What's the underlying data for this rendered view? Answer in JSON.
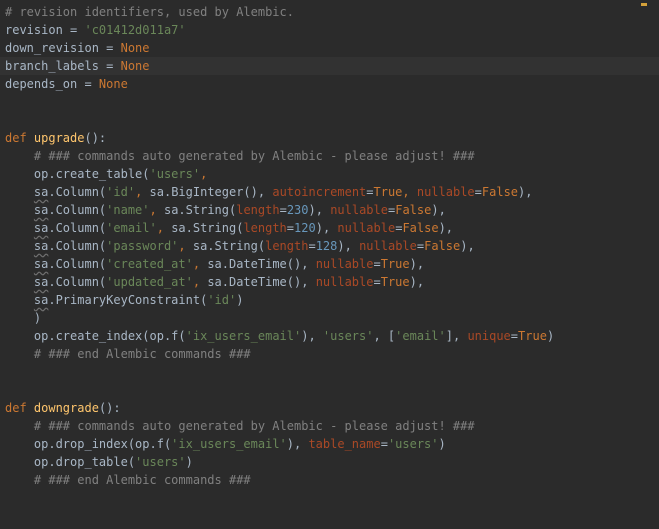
{
  "editor": {
    "current_line_index": 3,
    "lines": [
      [
        {
          "t": "# revision identifiers, used by Alembic.",
          "c": "com"
        }
      ],
      [
        {
          "t": "revision = ",
          "c": "plain"
        },
        {
          "t": "'c01412d011a7'",
          "c": "str"
        }
      ],
      [
        {
          "t": "down_revision = ",
          "c": "plain"
        },
        {
          "t": "None",
          "c": "kw"
        }
      ],
      [
        {
          "t": "branch_labels = ",
          "c": "plain"
        },
        {
          "t": "None",
          "c": "kw"
        }
      ],
      [
        {
          "t": "depends_on = ",
          "c": "plain"
        },
        {
          "t": "None",
          "c": "kw"
        }
      ],
      [],
      [],
      [
        {
          "t": "def ",
          "c": "kw"
        },
        {
          "t": "upgrade",
          "c": "fn"
        },
        {
          "t": "():",
          "c": "plain"
        }
      ],
      [
        {
          "t": "    # ### commands auto generated by Alembic - please adjust! ###",
          "c": "com"
        }
      ],
      [
        {
          "t": "    op.create_table(",
          "c": "plain"
        },
        {
          "t": "'users'",
          "c": "str"
        },
        {
          "t": ",",
          "c": "kw"
        }
      ],
      [
        {
          "t": "    ",
          "c": "plain"
        },
        {
          "t": "sa",
          "c": "sq"
        },
        {
          "t": ".Column(",
          "c": "plain"
        },
        {
          "t": "'id'",
          "c": "str"
        },
        {
          "t": ", ",
          "c": "kw"
        },
        {
          "t": "sa.BigInteger(), ",
          "c": "plain"
        },
        {
          "t": "autoincrement",
          "c": "kwarg"
        },
        {
          "t": "=",
          "c": "plain"
        },
        {
          "t": "True",
          "c": "kw"
        },
        {
          "t": ", ",
          "c": "kw"
        },
        {
          "t": "nullable",
          "c": "kwarg"
        },
        {
          "t": "=",
          "c": "plain"
        },
        {
          "t": "False",
          "c": "kw"
        },
        {
          "t": "),",
          "c": "plain"
        }
      ],
      [
        {
          "t": "    ",
          "c": "plain"
        },
        {
          "t": "sa",
          "c": "sq"
        },
        {
          "t": ".Column(",
          "c": "plain"
        },
        {
          "t": "'name'",
          "c": "str"
        },
        {
          "t": ", ",
          "c": "kw"
        },
        {
          "t": "sa.String(",
          "c": "plain"
        },
        {
          "t": "length",
          "c": "kwarg"
        },
        {
          "t": "=",
          "c": "plain"
        },
        {
          "t": "230",
          "c": "num"
        },
        {
          "t": "), ",
          "c": "plain"
        },
        {
          "t": "nullable",
          "c": "kwarg"
        },
        {
          "t": "=",
          "c": "plain"
        },
        {
          "t": "False",
          "c": "kw"
        },
        {
          "t": "),",
          "c": "plain"
        }
      ],
      [
        {
          "t": "    ",
          "c": "plain"
        },
        {
          "t": "sa",
          "c": "sq"
        },
        {
          "t": ".Column(",
          "c": "plain"
        },
        {
          "t": "'email'",
          "c": "str"
        },
        {
          "t": ", ",
          "c": "kw"
        },
        {
          "t": "sa.String(",
          "c": "plain"
        },
        {
          "t": "length",
          "c": "kwarg"
        },
        {
          "t": "=",
          "c": "plain"
        },
        {
          "t": "120",
          "c": "num"
        },
        {
          "t": "), ",
          "c": "plain"
        },
        {
          "t": "nullable",
          "c": "kwarg"
        },
        {
          "t": "=",
          "c": "plain"
        },
        {
          "t": "False",
          "c": "kw"
        },
        {
          "t": "),",
          "c": "plain"
        }
      ],
      [
        {
          "t": "    ",
          "c": "plain"
        },
        {
          "t": "sa",
          "c": "sq"
        },
        {
          "t": ".Column(",
          "c": "plain"
        },
        {
          "t": "'password'",
          "c": "str"
        },
        {
          "t": ", ",
          "c": "kw"
        },
        {
          "t": "sa.String(",
          "c": "plain"
        },
        {
          "t": "length",
          "c": "kwarg"
        },
        {
          "t": "=",
          "c": "plain"
        },
        {
          "t": "128",
          "c": "num"
        },
        {
          "t": "), ",
          "c": "plain"
        },
        {
          "t": "nullable",
          "c": "kwarg"
        },
        {
          "t": "=",
          "c": "plain"
        },
        {
          "t": "False",
          "c": "kw"
        },
        {
          "t": "),",
          "c": "plain"
        }
      ],
      [
        {
          "t": "    ",
          "c": "plain"
        },
        {
          "t": "sa",
          "c": "sq"
        },
        {
          "t": ".Column(",
          "c": "plain"
        },
        {
          "t": "'created_at'",
          "c": "str"
        },
        {
          "t": ", ",
          "c": "kw"
        },
        {
          "t": "sa.DateTime(), ",
          "c": "plain"
        },
        {
          "t": "nullable",
          "c": "kwarg"
        },
        {
          "t": "=",
          "c": "plain"
        },
        {
          "t": "True",
          "c": "kw"
        },
        {
          "t": "),",
          "c": "plain"
        }
      ],
      [
        {
          "t": "    ",
          "c": "plain"
        },
        {
          "t": "sa",
          "c": "sq"
        },
        {
          "t": ".Column(",
          "c": "plain"
        },
        {
          "t": "'updated_at'",
          "c": "str"
        },
        {
          "t": ", ",
          "c": "kw"
        },
        {
          "t": "sa.DateTime(), ",
          "c": "plain"
        },
        {
          "t": "nullable",
          "c": "kwarg"
        },
        {
          "t": "=",
          "c": "plain"
        },
        {
          "t": "True",
          "c": "kw"
        },
        {
          "t": "),",
          "c": "plain"
        }
      ],
      [
        {
          "t": "    ",
          "c": "plain"
        },
        {
          "t": "sa",
          "c": "sq"
        },
        {
          "t": ".PrimaryKeyConstraint(",
          "c": "plain"
        },
        {
          "t": "'id'",
          "c": "str"
        },
        {
          "t": ")",
          "c": "plain"
        }
      ],
      [
        {
          "t": "    )",
          "c": "plain"
        }
      ],
      [
        {
          "t": "    op.create_index(op.f(",
          "c": "plain"
        },
        {
          "t": "'ix_users_email'",
          "c": "str"
        },
        {
          "t": "), ",
          "c": "plain"
        },
        {
          "t": "'users'",
          "c": "str"
        },
        {
          "t": ", [",
          "c": "plain"
        },
        {
          "t": "'email'",
          "c": "str"
        },
        {
          "t": "], ",
          "c": "plain"
        },
        {
          "t": "unique",
          "c": "kwarg"
        },
        {
          "t": "=",
          "c": "plain"
        },
        {
          "t": "True",
          "c": "kw"
        },
        {
          "t": ")",
          "c": "plain"
        }
      ],
      [
        {
          "t": "    # ### end Alembic commands ###",
          "c": "com"
        }
      ],
      [],
      [],
      [
        {
          "t": "def ",
          "c": "kw"
        },
        {
          "t": "downgrade",
          "c": "fn"
        },
        {
          "t": "():",
          "c": "plain"
        }
      ],
      [
        {
          "t": "    # ### commands auto generated by Alembic - please adjust! ###",
          "c": "com"
        }
      ],
      [
        {
          "t": "    op.drop_index(op.f(",
          "c": "plain"
        },
        {
          "t": "'ix_users_email'",
          "c": "str"
        },
        {
          "t": "), ",
          "c": "plain"
        },
        {
          "t": "table_name",
          "c": "kwarg"
        },
        {
          "t": "=",
          "c": "plain"
        },
        {
          "t": "'users'",
          "c": "str"
        },
        {
          "t": ")",
          "c": "plain"
        }
      ],
      [
        {
          "t": "    op.drop_table(",
          "c": "plain"
        },
        {
          "t": "'users'",
          "c": "str"
        },
        {
          "t": ")",
          "c": "plain"
        }
      ],
      [
        {
          "t": "    # ### end Alembic commands ###",
          "c": "com"
        }
      ]
    ],
    "fold_marker_lines": [
      7,
      22
    ],
    "colors": {
      "background": "#2b2b2b",
      "current_line": "#323232",
      "comment": "#808080",
      "keyword": "#cc7832",
      "function": "#ffc66d",
      "string": "#6a8759",
      "number": "#6897bb",
      "kwarg": "#aa4926",
      "plain": "#a9b7c6",
      "warning_marker": "#d4a13a"
    }
  }
}
